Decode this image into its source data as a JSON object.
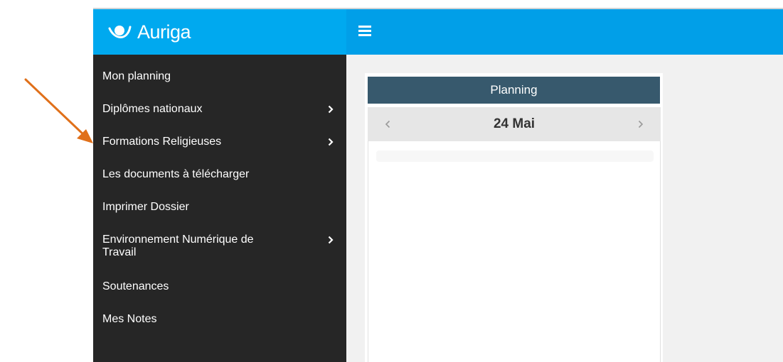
{
  "brand": {
    "name": "Auriga",
    "logo_icon": "auriga-logo-icon"
  },
  "header": {
    "menu_icon": "hamburger-icon"
  },
  "sidebar": {
    "items": [
      {
        "label": "Mon planning",
        "has_submenu": false
      },
      {
        "label": "Diplômes nationaux",
        "has_submenu": true
      },
      {
        "label": "Formations Religieuses",
        "has_submenu": true
      },
      {
        "label": "Les documents à télécharger",
        "has_submenu": false
      },
      {
        "label": "Imprimer Dossier",
        "has_submenu": false
      },
      {
        "label": "Environnement Numérique de Travail",
        "has_submenu": true
      },
      {
        "label": "Soutenances",
        "has_submenu": false
      },
      {
        "label": "Mes Notes",
        "has_submenu": false
      }
    ]
  },
  "planning": {
    "title": "Planning",
    "date": "24 Mai",
    "prev_icon": "chevron-left-icon",
    "next_icon": "chevron-right-icon"
  },
  "colors": {
    "brand_blue": "#00a9ef",
    "topbar_blue": "#019fe8",
    "sidebar_bg": "#262626",
    "panel_header": "#37596d",
    "annotation_arrow": "#e0701a"
  }
}
